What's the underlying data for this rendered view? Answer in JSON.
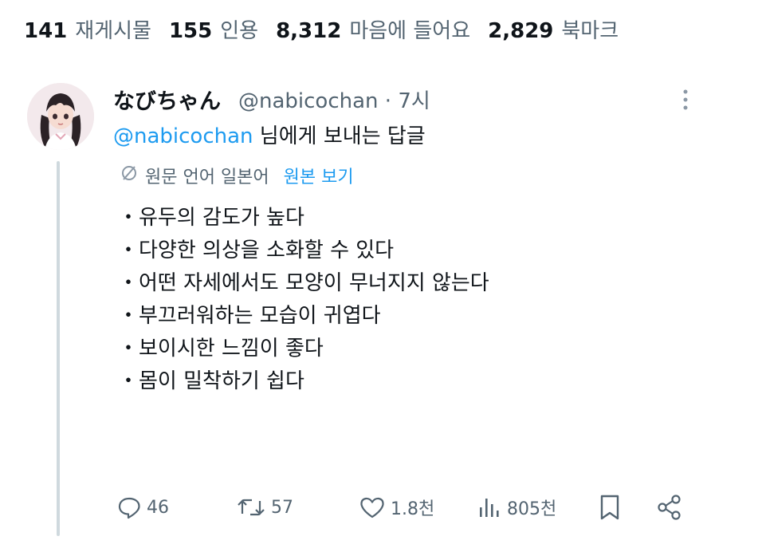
{
  "stats": [
    {
      "count": "141",
      "label": "재게시물"
    },
    {
      "count": "155",
      "label": "인용"
    },
    {
      "count": "8,312",
      "label": "마음에 들어요"
    },
    {
      "count": "2,829",
      "label": "북마크"
    }
  ],
  "reply": {
    "display_name": "なびちゃん",
    "handle_time": "@nabicochan · 7시",
    "reply_to_mention": "@nabicochan",
    "reply_to_text": " 님에게 보내는 답글",
    "translation_note": "원문 언어 일본어",
    "translation_link": "원본 보기",
    "lines": [
      "・유두의 감도가 높다",
      "・다양한 의상을 소화할 수 있다",
      "・어떤 자세에서도 모양이 무너지지 않는다",
      "・부끄러워하는 모습이 귀엽다",
      "・보이시한 느낌이 좋다",
      "・몸이 밀착하기 쉽다"
    ],
    "actions": {
      "replies": "46",
      "reposts": "57",
      "likes": "1.8천",
      "views": "805천"
    }
  },
  "colors": {
    "text": "#0f1419",
    "secondary": "#536471",
    "link": "#1d9bf0",
    "thread_line": "#cfd9de"
  },
  "icons": [
    "translate-icon",
    "more-icon",
    "reply-icon",
    "repost-icon",
    "like-icon",
    "views-icon",
    "bookmark-icon",
    "share-icon"
  ]
}
